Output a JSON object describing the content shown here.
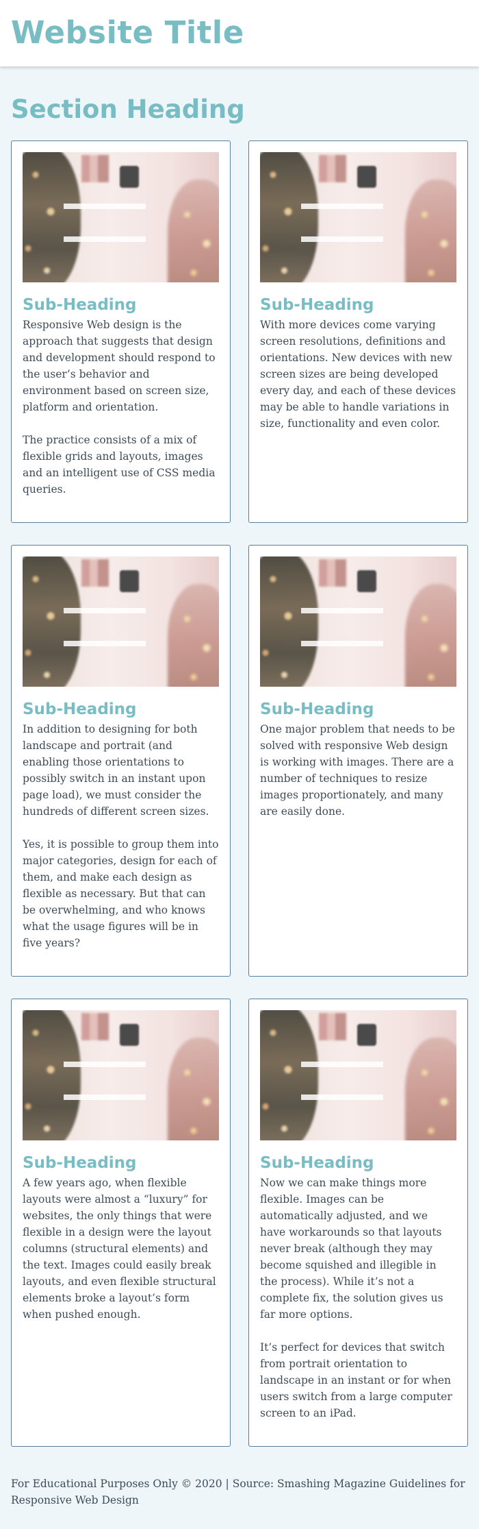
{
  "header": {
    "title": "Website Title"
  },
  "section": {
    "heading": "Section Heading"
  },
  "cards": [
    {
      "heading": "Sub-Heading",
      "paragraphs": [
        "Responsive Web design is the approach that suggests that design and development should respond to the user’s behavior and environment based on screen size, platform and orientation.",
        "The practice consists of a mix of flexible grids and layouts, images and an intelligent use of CSS media queries."
      ]
    },
    {
      "heading": "Sub-Heading",
      "paragraphs": [
        "With more devices come varying screen resolutions, definitions and orientations. New devices with new screen sizes are being developed every day, and each of these devices may be able to handle variations in size, functionality and even color."
      ]
    },
    {
      "heading": "Sub-Heading",
      "paragraphs": [
        "In addition to designing for both landscape and portrait (and enabling those orientations to possibly switch in an instant upon page load), we must consider the hundreds of different screen sizes.",
        "Yes, it is possible to group them into major categories, design for each of them, and make each design as flexible as necessary. But that can be overwhelming, and who knows what the usage figures will be in five years?"
      ]
    },
    {
      "heading": "Sub-Heading",
      "paragraphs": [
        "One major problem that needs to be solved with responsive Web design is working with images. There are a number of techniques to resize images proportionately, and many are easily done."
      ]
    },
    {
      "heading": "Sub-Heading",
      "paragraphs": [
        "A few years ago, when flexible layouts were almost a “luxury” for websites, the only things that were flexible in a design were the layout columns (structural elements) and the text. Images could easily break layouts, and even flexible structural elements broke a layout’s form when pushed enough."
      ]
    },
    {
      "heading": "Sub-Heading",
      "paragraphs": [
        "Now we can make things more flexible. Images can be automatically adjusted, and we have workarounds so that layouts never break (although they may become squished and illegible in the process). While it’s not a complete fix, the solution gives us far more options.",
        "It’s perfect for devices that switch from portrait orientation to landscape in an instant or for when users switch from a large computer screen to an iPad."
      ]
    }
  ],
  "footer": {
    "text": "For Educational Purposes Only © 2020 | Source: Smashing Magazine Guidelines for Responsive Web Design"
  }
}
